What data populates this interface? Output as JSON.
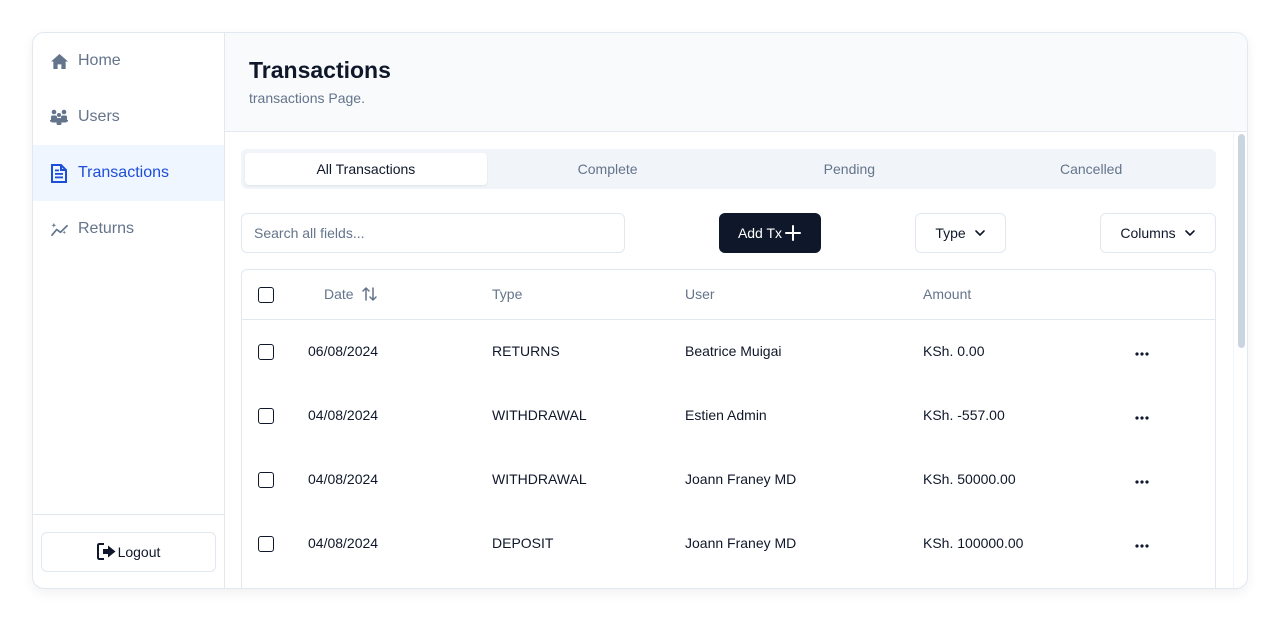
{
  "sidebar": {
    "items": [
      {
        "label": "Home",
        "icon": "home-icon"
      },
      {
        "label": "Users",
        "icon": "users-icon"
      },
      {
        "label": "Transactions",
        "icon": "file-text-icon"
      },
      {
        "label": "Returns",
        "icon": "chart-sparkle-icon"
      }
    ],
    "active_index": 2,
    "logout_label": "Logout"
  },
  "header": {
    "title": "Transactions",
    "subtitle": "transactions Page."
  },
  "tabs": [
    "All Transactions",
    "Complete",
    "Pending",
    "Cancelled"
  ],
  "active_tab": 0,
  "toolbar": {
    "search_placeholder": "Search all fields...",
    "add_label": "Add Tx",
    "type_label": "Type",
    "columns_label": "Columns"
  },
  "table": {
    "headers": {
      "date": "Date",
      "type": "Type",
      "user": "User",
      "amount": "Amount"
    },
    "rows": [
      {
        "date": "06/08/2024",
        "type": "RETURNS",
        "user": "Beatrice Muigai",
        "amount": "KSh. 0.00"
      },
      {
        "date": "04/08/2024",
        "type": "WITHDRAWAL",
        "user": "Estien Admin",
        "amount": "KSh. -557.00"
      },
      {
        "date": "04/08/2024",
        "type": "WITHDRAWAL",
        "user": "Joann Franey MD",
        "amount": "KSh. 50000.00"
      },
      {
        "date": "04/08/2024",
        "type": "DEPOSIT",
        "user": "Joann Franey MD",
        "amount": "KSh. 100000.00"
      }
    ]
  },
  "colors": {
    "accent": "#1d4ed8",
    "accent_bg": "#eff6ff",
    "primary_button": "#0f172a",
    "muted_text": "#64748b",
    "border": "#e2e8f0"
  }
}
